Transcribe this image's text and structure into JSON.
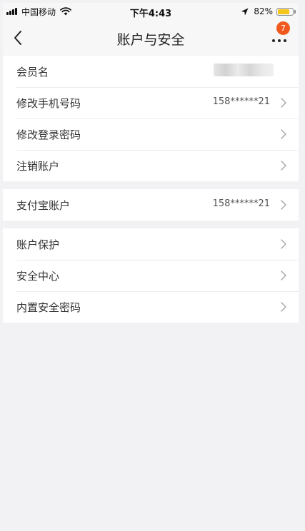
{
  "status_bar": {
    "carrier": "中国移动",
    "time": "下午4:43",
    "battery_percent": "82%",
    "battery_level": 0.82,
    "battery_color": "#f4c51a",
    "signal_bars": 4,
    "icons": [
      "signal-icon",
      "wifi-icon",
      "location-arrow-icon",
      "battery-icon"
    ]
  },
  "nav": {
    "title": "账户与安全",
    "back_icon": "chevron-left-icon",
    "more_icon": "more-dots-icon",
    "badge_count": "7",
    "badge_color": "#f05a1e"
  },
  "groups": [
    {
      "rows": [
        {
          "label": "会员名",
          "value": "",
          "value_blurred": true,
          "has_chevron": false
        },
        {
          "label": "修改手机号码",
          "value": "158******21",
          "has_chevron": true
        },
        {
          "label": "修改登录密码",
          "value": "",
          "has_chevron": true
        },
        {
          "label": "注销账户",
          "value": "",
          "has_chevron": true
        }
      ]
    },
    {
      "rows": [
        {
          "label": "支付宝账户",
          "value": "158******21",
          "has_chevron": true
        }
      ]
    },
    {
      "rows": [
        {
          "label": "账户保护",
          "value": "",
          "has_chevron": true
        },
        {
          "label": "安全中心",
          "value": "",
          "has_chevron": true
        },
        {
          "label": "内置安全密码",
          "value": "",
          "has_chevron": true
        }
      ]
    }
  ]
}
